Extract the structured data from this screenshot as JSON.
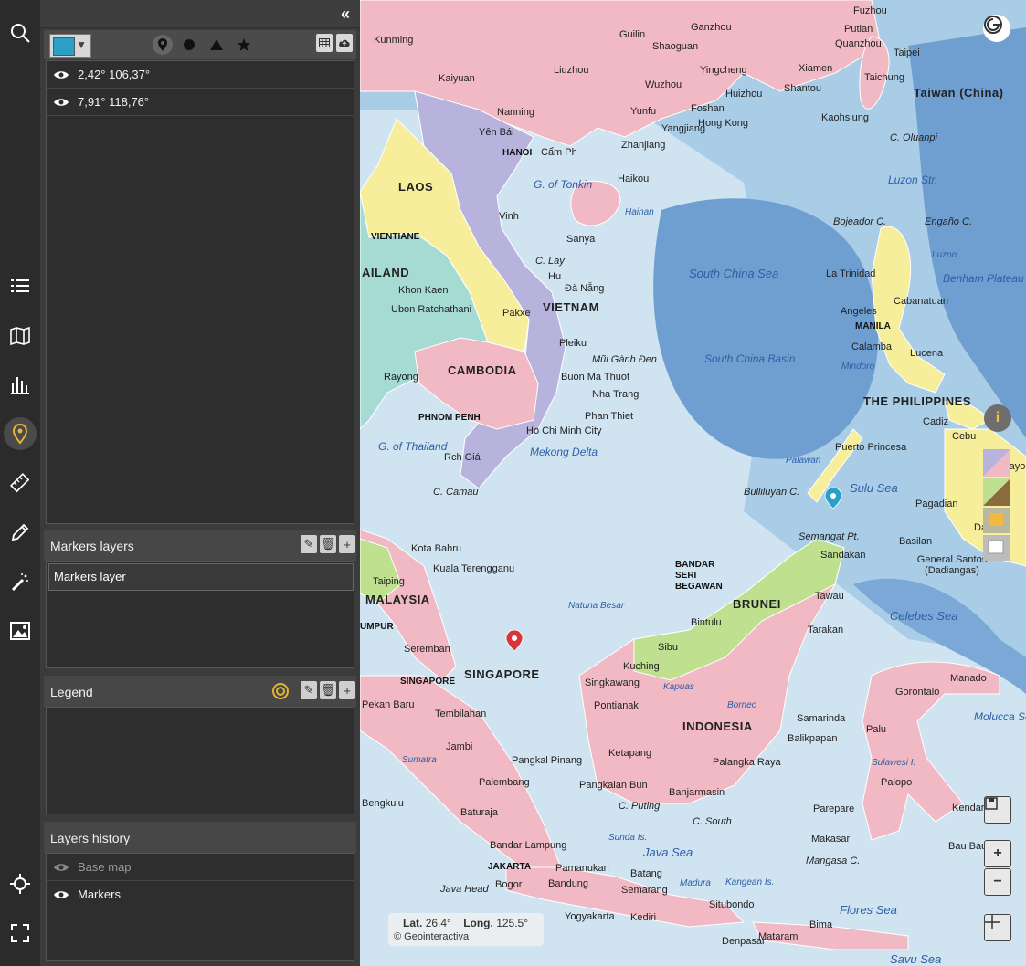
{
  "rail": {
    "icons": [
      "search-icon",
      "list-icon",
      "map-book-icon",
      "chart-icon",
      "marker-icon",
      "ruler-icon",
      "pencil-icon",
      "magic-wand-icon",
      "image-icon",
      "crosshair-icon",
      "fullscreen-icon"
    ]
  },
  "toolbar": {
    "color": "#2aa0c6",
    "shapes": [
      "pin",
      "circle",
      "triangle",
      "star"
    ]
  },
  "markers": [
    {
      "label": "2,42° 106,37°"
    },
    {
      "label": "7,91° 118,76°"
    }
  ],
  "markers_layers": {
    "title": "Markers layers",
    "items": [
      "Markers layer"
    ]
  },
  "legend": {
    "title": "Legend"
  },
  "history": {
    "title": "Layers history",
    "items": [
      {
        "label": "Base map",
        "dim": true
      },
      {
        "label": "Markers",
        "dim": false
      }
    ]
  },
  "map": {
    "countries": [
      "LAOS",
      "VIETNAM",
      "CAMBODIA",
      "AILAND",
      "MALAYSIA",
      "SINGAPORE",
      "BRUNEI",
      "INDONESIA",
      "THE PHILIPPINES",
      "Taiwan (China)"
    ],
    "seas": [
      "South China Sea",
      "South China Basin",
      "G. of Tonkin",
      "G. of Thailand",
      "Mekong Delta",
      "Sulu Sea",
      "Celebes Sea",
      "Java Sea",
      "Flores Sea",
      "Savu Sea",
      "Luzon Str.",
      "Benham Plateau",
      "Molucca Sea",
      "Hainan",
      "Mindoro",
      "Palawan",
      "Sunda Is.",
      "Natuna Besar",
      "Borneo",
      "Kapuas",
      "Sumatra",
      "Madura",
      "Kangean Is.",
      "Sulawesi I.",
      "Luzon"
    ],
    "cities": [
      "Kunming",
      "Guilin",
      "Ganzhou",
      "Fuzhou",
      "Putian",
      "Quanzhou",
      "Shaoguan",
      "Kaiyuan",
      "Liuzhou",
      "Yingcheng",
      "Xiamen",
      "Taipei",
      "Taichung",
      "Wuzhou",
      "Foshan",
      "Huizhou",
      "Shantou",
      "Yunfu",
      "Hong Kong",
      "Kaohsiung",
      "Yangjiang",
      "Nanning",
      "Zhanjiang",
      "Yên Bái",
      "HANOI",
      "Cẩm Ph",
      "Haikou",
      "Vinh",
      "Sanya",
      "VIENTIANE",
      "C. Lay",
      "Hu",
      "Đà Nẵng",
      "Khon Kaen",
      "Ubon Ratchathani",
      "Pakxe",
      "Pleiku",
      "Rayong",
      "Buon Ma Thuot",
      "Nha Trang",
      "PHNOM PENH",
      "Phan Thiet",
      "Ho Chi Minh City",
      "Rch Giá",
      "C. Camau",
      "Kota Bahru",
      "Kuala Terengganu",
      "Taiping",
      "UMPUR",
      "Seremban",
      "SINGAPORE",
      "Pekan Baru",
      "Tembilahan",
      "Jambi",
      "Pangkal Pinang",
      "Palembang",
      "Bengkulu",
      "Baturaja",
      "Bandar Lampung",
      "JAKARTA",
      "Pamanukan",
      "Bandung",
      "Bogor",
      "Java Head",
      "Batang",
      "Semarang",
      "Yogyakarta",
      "Kediri",
      "Situbondo",
      "Bima",
      "Mataram",
      "Denpasar",
      "Singkawang",
      "Pontianak",
      "Ketapang",
      "Pangkalan Bun",
      "Banjarmasin",
      "C. Puting",
      "C. South",
      "Palangka Raya",
      "Kuching",
      "Sibu",
      "Bintulu",
      "BANDAR SERI BEGAWAN",
      "Tawau",
      "Tarakan",
      "Sandakan",
      "Samarinda",
      "Balikpapan",
      "Palu",
      "Gorontalo",
      "Manado",
      "Palopo",
      "Parepare",
      "Makasar",
      "Mangasa C.",
      "Kendari",
      "Bau Bau",
      "La Trinidad",
      "Cabanatuan",
      "Angeles",
      "MANILA",
      "Calamba",
      "Lucena",
      "Cadiz",
      "Cebu",
      "Puerto Princesa",
      "Pagadian",
      "Davao",
      "Basilan",
      "General Santos (Dadiangas)",
      "Bojeador C.",
      "Engaño C.",
      "Bulliluyan C.",
      "Semangat Pt.",
      "Calbayog",
      "C. Oluanpi",
      "Mũi Gành Đen"
    ],
    "coord_lat_label": "Lat.",
    "coord_lat": "26.4°",
    "coord_long_label": "Long.",
    "coord_long": "125.5°",
    "copyright": "© Geointeractiva"
  }
}
